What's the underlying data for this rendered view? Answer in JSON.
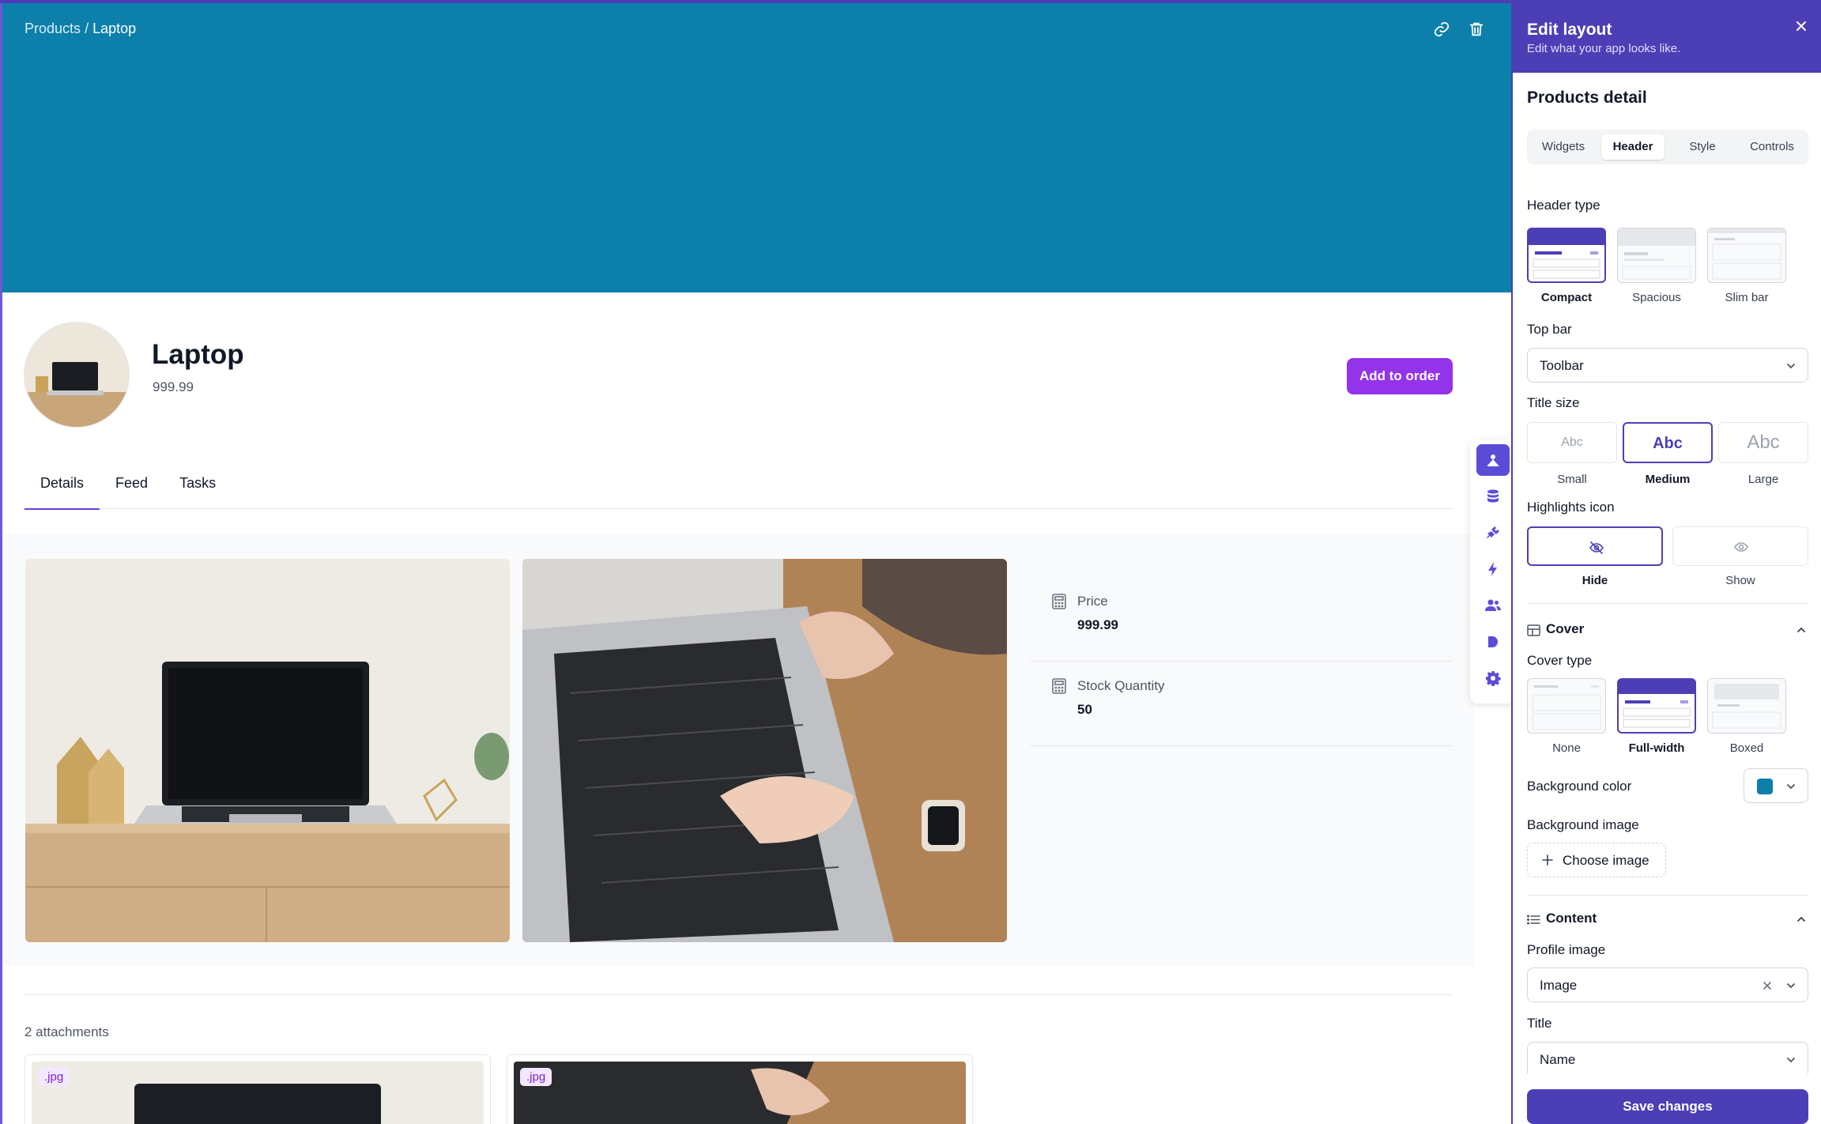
{
  "colors": {
    "cover": "#0c7fab",
    "accent": "#4c3fb5",
    "primary_button": "#9333ea"
  },
  "breadcrumb": {
    "parent": "Products",
    "separator": "/",
    "current": "Laptop"
  },
  "cover_actions": {
    "link_icon": "link-icon",
    "delete_icon": "trash-icon"
  },
  "record": {
    "title": "Laptop",
    "subtitle": "999.99",
    "action_label": "Add to order"
  },
  "tabs": [
    {
      "label": "Details",
      "active": true
    },
    {
      "label": "Feed",
      "active": false
    },
    {
      "label": "Tasks",
      "active": false
    }
  ],
  "fields": [
    {
      "label": "Price",
      "value": "999.99",
      "icon": "calculator-icon"
    },
    {
      "label": "Stock Quantity",
      "value": "50",
      "icon": "calculator-icon"
    }
  ],
  "attachments": {
    "count_label": "2 attachments",
    "items": [
      {
        "badge": ".jpg"
      },
      {
        "badge": ".jpg"
      }
    ]
  },
  "side_toolbar": [
    "layout-icon",
    "database-icon",
    "plug-icon",
    "bolt-icon",
    "users-icon",
    "play-icon",
    "gear-icon"
  ],
  "panel": {
    "title": "Edit layout",
    "subtitle": "Edit what your app looks like.",
    "section_title": "Products detail",
    "tabs": [
      {
        "label": "Widgets",
        "active": false
      },
      {
        "label": "Header",
        "active": true
      },
      {
        "label": "Style",
        "active": false
      },
      {
        "label": "Controls",
        "active": false
      }
    ],
    "header_type": {
      "label": "Header type",
      "options": [
        {
          "label": "Compact",
          "selected": true
        },
        {
          "label": "Spacious",
          "selected": false
        },
        {
          "label": "Slim bar",
          "selected": false
        }
      ]
    },
    "top_bar": {
      "label": "Top bar",
      "value": "Toolbar"
    },
    "title_size": {
      "label": "Title size",
      "sample": "Abc",
      "options": [
        {
          "label": "Small",
          "selected": false
        },
        {
          "label": "Medium",
          "selected": true
        },
        {
          "label": "Large",
          "selected": false
        }
      ]
    },
    "highlights_icon": {
      "label": "Highlights icon",
      "options": [
        {
          "label": "Hide",
          "selected": true,
          "icon": "eye-off-icon"
        },
        {
          "label": "Show",
          "selected": false,
          "icon": "eye-icon"
        }
      ]
    },
    "cover": {
      "title": "Cover",
      "type_label": "Cover type",
      "options": [
        {
          "label": "None",
          "selected": false
        },
        {
          "label": "Full-width",
          "selected": true
        },
        {
          "label": "Boxed",
          "selected": false
        }
      ],
      "bg_color_label": "Background color",
      "bg_color": "#0c7fab",
      "bg_image_label": "Background image",
      "choose_image": "Choose image"
    },
    "content": {
      "title": "Content",
      "profile_image_label": "Profile image",
      "profile_image_value": "Image",
      "title_label": "Title",
      "title_value": "Name"
    },
    "save_label": "Save changes"
  }
}
